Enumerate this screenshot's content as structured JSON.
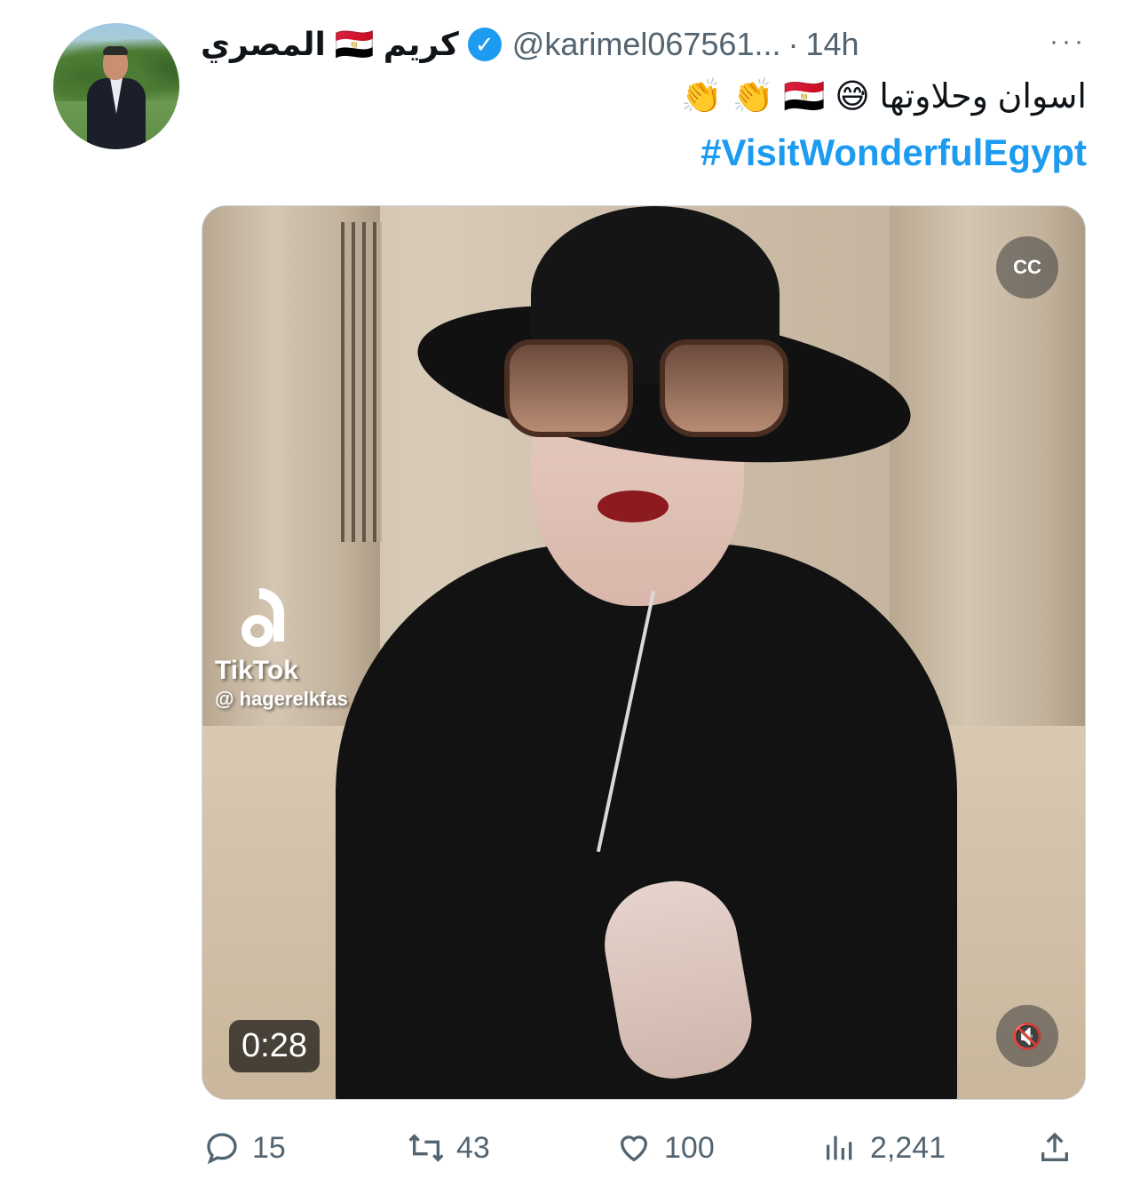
{
  "tweet": {
    "author_name": "كريم 🇪🇬 المصري",
    "handle": "@karimel067561...",
    "separator": "·",
    "time": "14h",
    "more": "···",
    "text": "اسوان وحلاوتها 😅 🇪🇬 👏 👏",
    "hashtag": "#VisitWonderfulEgypt"
  },
  "media": {
    "watermark_brand": "TikTok",
    "watermark_user": "@ hagerelkfas",
    "duration": "0:28",
    "cc_label": "CC",
    "mute_icon": "speaker-muted-icon"
  },
  "actions": {
    "replies": "15",
    "retweets": "43",
    "likes": "100",
    "views": "2,241"
  },
  "colors": {
    "accent": "#1d9bf0",
    "secondary_text": "#536471",
    "primary_text": "#0f1419"
  }
}
